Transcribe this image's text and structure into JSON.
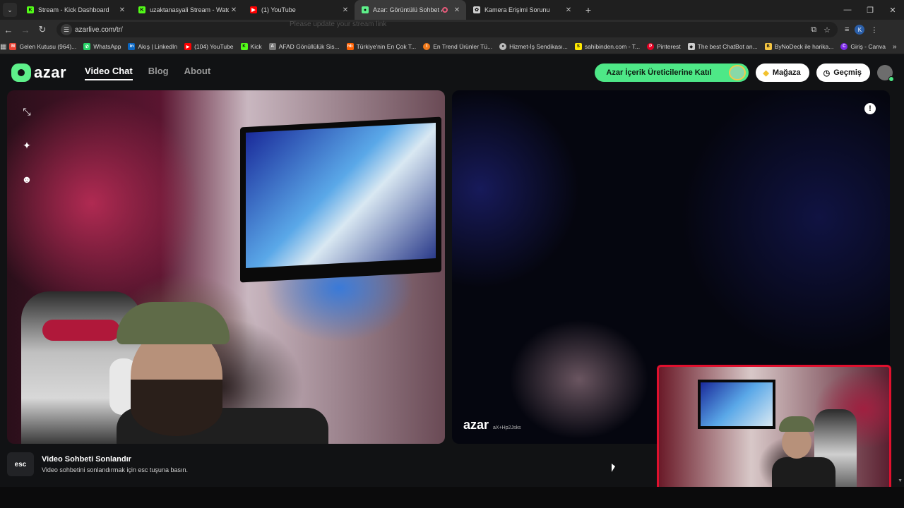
{
  "browser": {
    "tabs": [
      {
        "title": "Stream - Kick Dashboard",
        "icon": "kick-icon",
        "color": "#53fc18"
      },
      {
        "title": "uzaktanasyali Stream - Watch Live",
        "icon": "kick-icon",
        "color": "#53fc18"
      },
      {
        "title": "(1) YouTube",
        "icon": "youtube-icon",
        "color": "#ff0000"
      },
      {
        "title": "Azar: Görüntülü Sohbet & Video Chat",
        "icon": "azar-icon",
        "color": "#5ef08a",
        "active": true
      },
      {
        "title": "Kamera Erişimi Sorunu",
        "icon": "chatgpt-icon",
        "color": "#d0d0d0"
      }
    ],
    "url": "azarlive.com/tr/",
    "omnibox_hint": "Please update your stream link",
    "profile_initial": "K",
    "bookmarks": [
      {
        "label": "Gelen Kutusu (964)...",
        "icon": "gmail-icon",
        "color": "#ea4335"
      },
      {
        "label": "WhatsApp",
        "icon": "whatsapp-icon",
        "color": "#25d366"
      },
      {
        "label": "Akış | LinkedIn",
        "icon": "linkedin-icon",
        "color": "#0a66c2"
      },
      {
        "label": "(104) YouTube",
        "icon": "youtube-icon",
        "color": "#ff0000"
      },
      {
        "label": "Kick",
        "icon": "kick-icon",
        "color": "#53fc18"
      },
      {
        "label": "AFAD Gönüllülük Sis...",
        "icon": "afad-icon",
        "color": "#7a7a7a"
      },
      {
        "label": "Türkiye'nin En Çok T...",
        "icon": "hepsiburada-icon",
        "color": "#ff6000"
      },
      {
        "label": "En Trend Ürünler Tü...",
        "icon": "trendyol-icon",
        "color": "#f27a1a"
      },
      {
        "label": "Hizmet-İş Sendikası...",
        "icon": "union-icon",
        "color": "#bbbbbb"
      },
      {
        "label": "sahibinden.com - T...",
        "icon": "sahibinden-icon",
        "color": "#ffe800"
      },
      {
        "label": "Pinterest",
        "icon": "pinterest-icon",
        "color": "#e60023"
      },
      {
        "label": "The best ChatBot an...",
        "icon": "chatbot-icon",
        "color": "#cccccc"
      },
      {
        "label": "ByNoDeck ile harika...",
        "icon": "bynodeck-icon",
        "color": "#f5c542"
      },
      {
        "label": "Giriş - Canva",
        "icon": "canva-icon",
        "color": "#7d2ae8"
      }
    ]
  },
  "header": {
    "logo": "azar",
    "nav": [
      {
        "label": "Video Chat",
        "active": true
      },
      {
        "label": "Blog"
      },
      {
        "label": "About"
      }
    ],
    "creator_button": "Azar İçerik Üreticilerine Katıl",
    "shop_button": "Mağaza",
    "history_button": "Geçmiş"
  },
  "remote_video": {
    "watermark_logo": "azar",
    "watermark_id": "aX+Hp2Jsks"
  },
  "footer_hint": {
    "key": "esc",
    "title": "Video Sohbeti Sonlandır",
    "description": "Video sohbetini sonlandırmak için esc tuşuna basın."
  },
  "colors": {
    "accent_green": "#4ee887",
    "pip_border": "#e0102e",
    "background": "#111214"
  }
}
